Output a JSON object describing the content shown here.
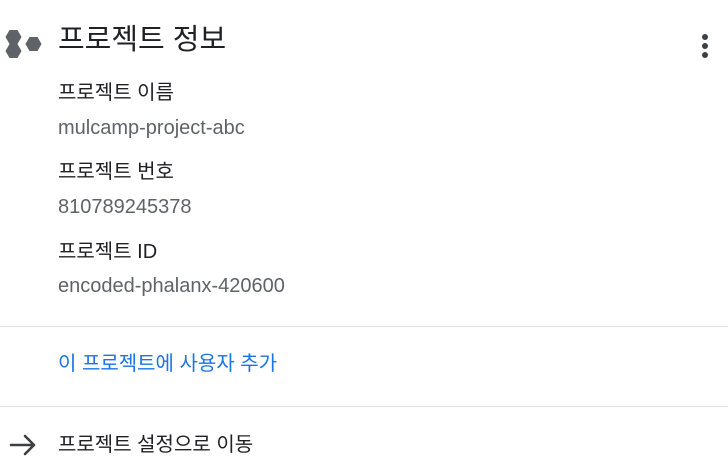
{
  "card": {
    "title": "프로젝트 정보",
    "icon": "project-hexagons-icon",
    "menu_icon": "more-vert-icon"
  },
  "fields": [
    {
      "label": "프로젝트 이름",
      "value": "mulcamp-project-abc"
    },
    {
      "label": "프로젝트 번호",
      "value": "810789245378"
    },
    {
      "label": "프로젝트 ID",
      "value": "encoded-phalanx-420600"
    }
  ],
  "actions": {
    "add_user": "이 프로젝트에 사용자 추가",
    "go_to_settings": "프로젝트 설정으로 이동",
    "settings_icon": "arrow-right-icon"
  },
  "colors": {
    "link": "#1a73e8",
    "text_primary": "#202124",
    "text_secondary": "#5f6368",
    "icon": "#5f6368",
    "divider": "#e0e0e0"
  }
}
